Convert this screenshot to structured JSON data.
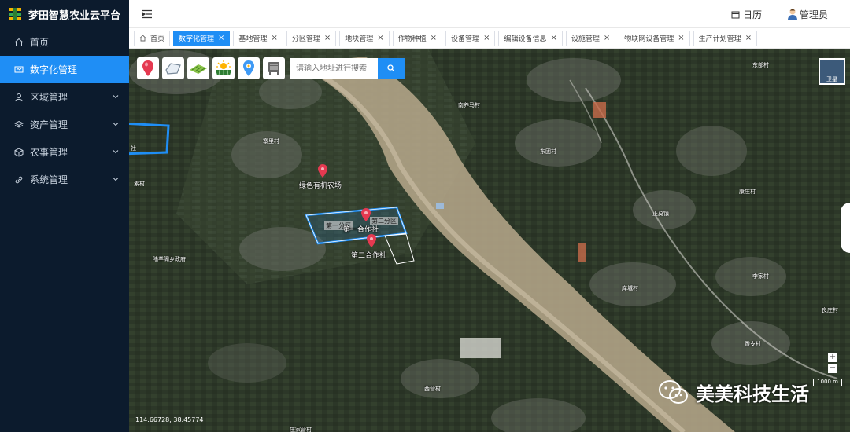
{
  "app": {
    "title": "梦田智慧农业云平台"
  },
  "sidebar": {
    "items": [
      {
        "label": "首页",
        "icon": "home-icon",
        "active": false,
        "expandable": false
      },
      {
        "label": "数字化管理",
        "icon": "monitor-icon",
        "active": true,
        "expandable": false
      },
      {
        "label": "区域管理",
        "icon": "user-icon",
        "active": false,
        "expandable": true
      },
      {
        "label": "资产管理",
        "icon": "layers-icon",
        "active": false,
        "expandable": true
      },
      {
        "label": "农事管理",
        "icon": "cube-icon",
        "active": false,
        "expandable": true
      },
      {
        "label": "系统管理",
        "icon": "link-icon",
        "active": false,
        "expandable": true
      }
    ]
  },
  "header": {
    "calendar_label": "日历",
    "user_label": "管理员"
  },
  "tabs": [
    {
      "label": "首页",
      "active": false,
      "closable": false
    },
    {
      "label": "数字化管理",
      "active": true,
      "closable": true
    },
    {
      "label": "基地管理",
      "active": false,
      "closable": true
    },
    {
      "label": "分区管理",
      "active": false,
      "closable": true
    },
    {
      "label": "地块管理",
      "active": false,
      "closable": true
    },
    {
      "label": "作物种植",
      "active": false,
      "closable": true
    },
    {
      "label": "设备管理",
      "active": false,
      "closable": true
    },
    {
      "label": "编辑设备信息",
      "active": false,
      "closable": true
    },
    {
      "label": "设施管理",
      "active": false,
      "closable": true
    },
    {
      "label": "物联网设备管理",
      "active": false,
      "closable": true
    },
    {
      "label": "生产计划管理",
      "active": false,
      "closable": true
    }
  ],
  "map": {
    "search_placeholder": "请输入地址进行搜索",
    "layer_label": "卫星",
    "zoom_in": "+",
    "zoom_out": "−",
    "scale": "1000 m",
    "coordinates": "114.66728, 38.45774",
    "farms": [
      {
        "label": "绿色有机农场"
      },
      {
        "label": "第一合作社"
      },
      {
        "label": "第二合作社"
      }
    ],
    "zones": [
      {
        "label": "第一分区"
      },
      {
        "label": "第二分区"
      }
    ],
    "places": [
      "东部村",
      "南养马村",
      "寨里村",
      "东固村",
      "素村",
      "康庄村",
      "正莫镇",
      "陆羊阁乡政府",
      "李家村",
      "库城村",
      "良庄村",
      "香支村",
      "西营村",
      "庄家营村",
      "社"
    ],
    "tool_icons": [
      "pin-tool-icon",
      "polygon-tool-icon",
      "field-tool-icon",
      "solar-tool-icon",
      "location-tool-icon",
      "device-tool-icon"
    ]
  },
  "watermark": {
    "text": "美美科技生活"
  }
}
